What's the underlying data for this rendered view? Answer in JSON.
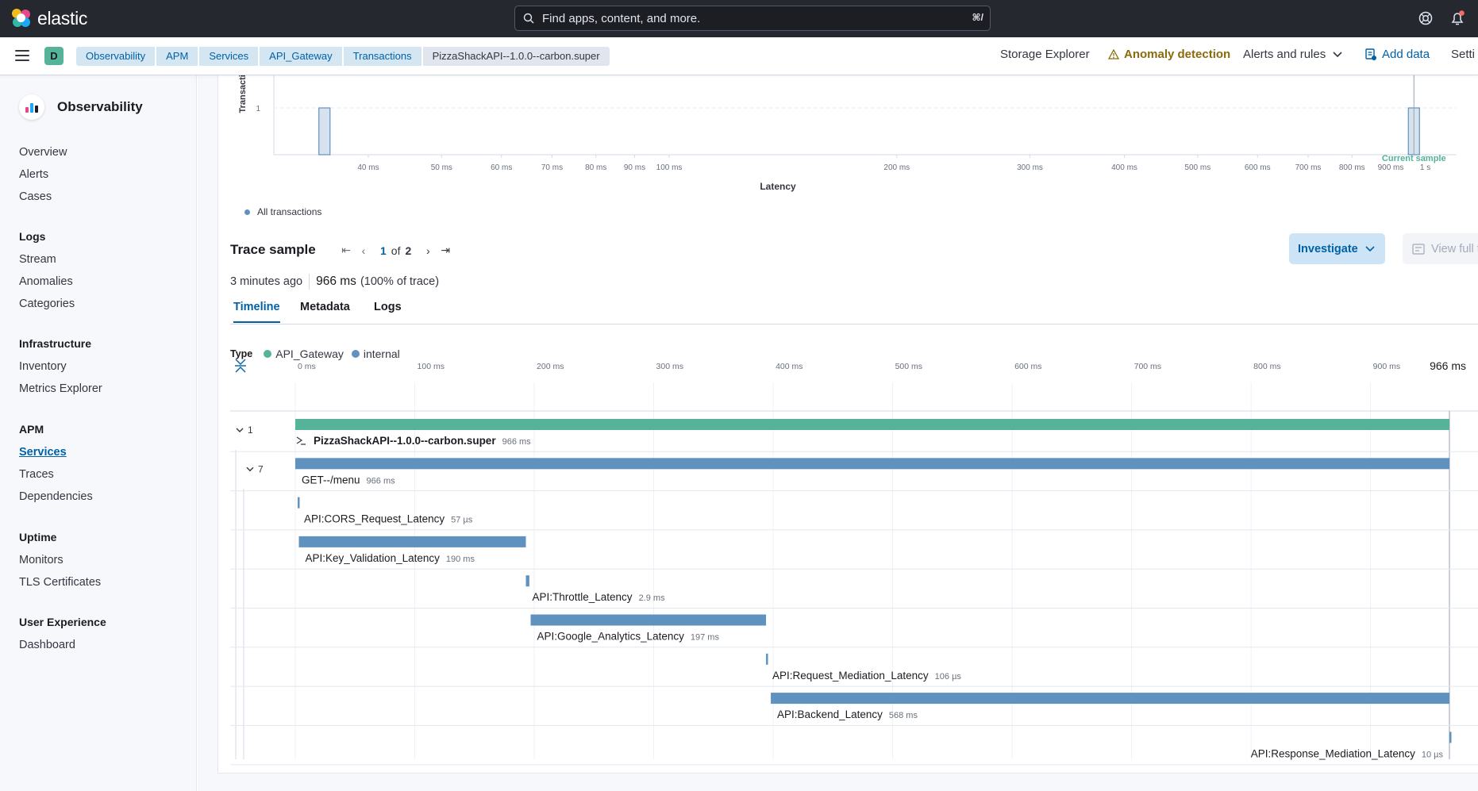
{
  "header": {
    "brand": "elastic",
    "search_placeholder": "Find apps, content, and more.",
    "search_shortcut": "⌘/",
    "help_icon": "help-icon",
    "notifications_icon": "notifications-icon"
  },
  "subbar": {
    "space_initial": "D",
    "breadcrumbs": [
      "Observability",
      "APM",
      "Services",
      "API_Gateway",
      "Transactions",
      "PizzaShackAPI--1.0.0--carbon.super"
    ],
    "storage_explorer": "Storage Explorer",
    "anomaly_detection": "Anomaly detection",
    "alerts_and_rules": "Alerts and rules",
    "add_data": "Add data",
    "settings": "Setti"
  },
  "sidenav": {
    "title": "Observability",
    "top_items": [
      "Overview",
      "Alerts",
      "Cases"
    ],
    "groups": [
      {
        "title": "Logs",
        "items": [
          "Stream",
          "Anomalies",
          "Categories"
        ]
      },
      {
        "title": "Infrastructure",
        "items": [
          "Inventory",
          "Metrics Explorer"
        ]
      },
      {
        "title": "APM",
        "items": [
          "Services",
          "Traces",
          "Dependencies"
        ]
      },
      {
        "title": "Uptime",
        "items": [
          "Monitors",
          "TLS Certificates"
        ]
      },
      {
        "title": "User Experience",
        "items": [
          "Dashboard"
        ]
      }
    ],
    "active_item": "Services"
  },
  "chart_data": {
    "type": "bar",
    "ylabel": "Transactio",
    "xlabel": "Latency",
    "y_ticks": [
      "1"
    ],
    "x_ticks": [
      "40 ms",
      "50 ms",
      "60 ms",
      "70 ms",
      "80 ms",
      "90 ms",
      "100 ms",
      "200 ms",
      "300 ms",
      "400 ms",
      "500 ms",
      "600 ms",
      "700 ms",
      "800 ms",
      "900 ms",
      "1 s"
    ],
    "x_scale": "log",
    "bars": [
      {
        "latency_ms": 35,
        "count": 1
      },
      {
        "latency_ms": 966,
        "count": 1
      }
    ],
    "annotation": "Current sample",
    "legend": "All transactions",
    "colors": {
      "bar": "#6092c0",
      "annotation": "#54b399"
    }
  },
  "trace": {
    "title": "Trace sample",
    "page": "1",
    "of": "of",
    "total": "2",
    "investigate": "Investigate",
    "view_full_trace": "View full trace",
    "age": "3 minutes ago",
    "duration": "966 ms",
    "percent": "(100% of trace)",
    "tabs": [
      "Timeline",
      "Metadata",
      "Logs"
    ],
    "type_label": "Type",
    "types": [
      {
        "name": "API_Gateway",
        "color": "#54b399"
      },
      {
        "name": "internal",
        "color": "#6092c0"
      }
    ]
  },
  "waterfall": {
    "axis_ticks": [
      "0 ms",
      "100 ms",
      "200 ms",
      "300 ms",
      "400 ms",
      "500 ms",
      "600 ms",
      "700 ms",
      "800 ms",
      "900 ms"
    ],
    "axis_end": "966 ms",
    "total_ms": 966,
    "rows": [
      {
        "name": "PizzaShackAPI--1.0.0--carbon.super",
        "duration": "966 ms",
        "start_ms": 0,
        "dur_ms": 966,
        "color": "#54b399",
        "bold": true,
        "count": "1"
      },
      {
        "name": "GET--/menu",
        "duration": "966 ms",
        "start_ms": 0,
        "dur_ms": 966,
        "color": "#6092c0",
        "count": "7"
      },
      {
        "name": "API:CORS_Request_Latency",
        "duration": "57 µs",
        "start_ms": 2,
        "dur_ms": 0.057,
        "color": "#6092c0"
      },
      {
        "name": "API:Key_Validation_Latency",
        "duration": "190 ms",
        "start_ms": 3,
        "dur_ms": 190,
        "color": "#6092c0"
      },
      {
        "name": "API:Throttle_Latency",
        "duration": "2.9 ms",
        "start_ms": 193,
        "dur_ms": 2.9,
        "color": "#6092c0"
      },
      {
        "name": "API:Google_Analytics_Latency",
        "duration": "197 ms",
        "start_ms": 197,
        "dur_ms": 197,
        "color": "#6092c0"
      },
      {
        "name": "API:Request_Mediation_Latency",
        "duration": "106 µs",
        "start_ms": 394,
        "dur_ms": 0.106,
        "color": "#6092c0"
      },
      {
        "name": "API:Backend_Latency",
        "duration": "568 ms",
        "start_ms": 398,
        "dur_ms": 568,
        "color": "#6092c0"
      },
      {
        "name": "API:Response_Mediation_Latency",
        "duration": "10 µs",
        "start_ms": 966,
        "dur_ms": 0.01,
        "color": "#6092c0",
        "align_right": true
      }
    ]
  }
}
